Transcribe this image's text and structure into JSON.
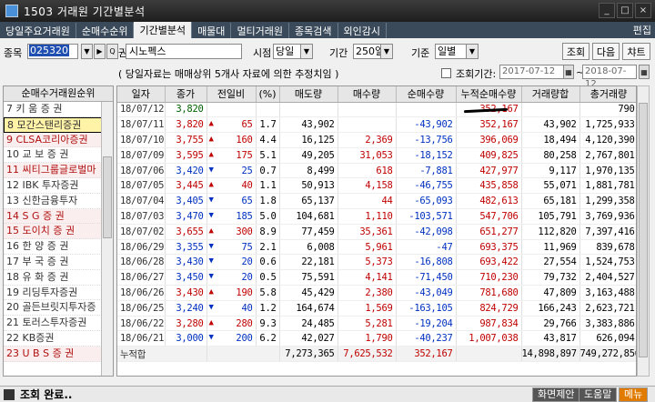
{
  "window": {
    "title": "1503 거래원 기간별분석",
    "edit_label": "편집"
  },
  "tabs": [
    "당일주요거래원",
    "순매수순위",
    "기간별분석",
    "매물대",
    "멀티거래원",
    "종목검색",
    "외인감시"
  ],
  "active_tab": "기간별분석",
  "controls": {
    "code_label": "종목",
    "code_value": "025320",
    "search_glyph": "Q",
    "right_label": "권",
    "name_value": "시노펙스",
    "timepoint_label": "시점",
    "timepoint_value": "당일",
    "period_label": "기간",
    "period_value": "250일",
    "basis_label": "기준",
    "basis_value": "일별",
    "query_btn": "조회",
    "next_btn": "다음",
    "chart_btn": "챠트",
    "note": "( 당일자료는 매매상위 5개사 자료에 의한 추정치임 )",
    "range_label": "조회기간:",
    "date_from": "2017-07-12",
    "date_to": "2018-07-12",
    "range_sep": "~"
  },
  "broker_list": {
    "header": "순매수거래원순위",
    "items": [
      {
        "label": "7 키 움 증 권",
        "style": "normal"
      },
      {
        "label": "8 모간스탠리증권",
        "style": "selected"
      },
      {
        "label": "9 CLSA코리아증권",
        "style": "red"
      },
      {
        "label": "10 교 보 증 권",
        "style": "normal"
      },
      {
        "label": "11 씨티그룹글로벌마",
        "style": "red"
      },
      {
        "label": "12 IBK 투자증권",
        "style": "normal"
      },
      {
        "label": "13 신한금융투자",
        "style": "normal"
      },
      {
        "label": "14 S G 증 권",
        "style": "red"
      },
      {
        "label": "15 도이치 증 권",
        "style": "red"
      },
      {
        "label": "16 한 양 증 권",
        "style": "normal"
      },
      {
        "label": "17 부 국 증 권",
        "style": "normal"
      },
      {
        "label": "18 유 화 증 권",
        "style": "normal"
      },
      {
        "label": "19 리딩투자증권",
        "style": "normal"
      },
      {
        "label": "20 골든브릿지투자증",
        "style": "normal"
      },
      {
        "label": "21 토러스투자증권",
        "style": "normal"
      },
      {
        "label": "22 KB증권",
        "style": "normal"
      },
      {
        "label": "23 U B S 증 권",
        "style": "red"
      }
    ]
  },
  "table": {
    "columns": [
      "일자",
      "종가",
      "전일비",
      "(%)",
      "매도량",
      "매수량",
      "순매수량",
      "누적순매수량",
      "거래량합",
      "총거래량"
    ],
    "rows": [
      {
        "date": "18/07/12",
        "close": "3,820",
        "dir": "",
        "chg": "",
        "pct": "",
        "sell": "",
        "buy": "",
        "net": "",
        "cum": "352,167",
        "vol": "",
        "total": "790"
      },
      {
        "date": "18/07/11",
        "close": "3,820",
        "dir": "up",
        "chg": "65",
        "pct": "1.7",
        "sell": "43,902",
        "buy": "",
        "net": "-43,902",
        "cum": "352,167",
        "vol": "43,902",
        "total": "1,725,933"
      },
      {
        "date": "18/07/10",
        "close": "3,755",
        "dir": "up",
        "chg": "160",
        "pct": "4.4",
        "sell": "16,125",
        "buy": "2,369",
        "net": "-13,756",
        "cum": "396,069",
        "vol": "18,494",
        "total": "4,120,390"
      },
      {
        "date": "18/07/09",
        "close": "3,595",
        "dir": "up",
        "chg": "175",
        "pct": "5.1",
        "sell": "49,205",
        "buy": "31,053",
        "net": "-18,152",
        "cum": "409,825",
        "vol": "80,258",
        "total": "2,767,801"
      },
      {
        "date": "18/07/06",
        "close": "3,420",
        "dir": "dn",
        "chg": "25",
        "pct": "0.7",
        "sell": "8,499",
        "buy": "618",
        "net": "-7,881",
        "cum": "427,977",
        "vol": "9,117",
        "total": "1,970,135"
      },
      {
        "date": "18/07/05",
        "close": "3,445",
        "dir": "up",
        "chg": "40",
        "pct": "1.1",
        "sell": "50,913",
        "buy": "4,158",
        "net": "-46,755",
        "cum": "435,858",
        "vol": "55,071",
        "total": "1,881,781"
      },
      {
        "date": "18/07/04",
        "close": "3,405",
        "dir": "dn",
        "chg": "65",
        "pct": "1.8",
        "sell": "65,137",
        "buy": "44",
        "net": "-65,093",
        "cum": "482,613",
        "vol": "65,181",
        "total": "1,299,358"
      },
      {
        "date": "18/07/03",
        "close": "3,470",
        "dir": "dn",
        "chg": "185",
        "pct": "5.0",
        "sell": "104,681",
        "buy": "1,110",
        "net": "-103,571",
        "cum": "547,706",
        "vol": "105,791",
        "total": "3,769,936"
      },
      {
        "date": "18/07/02",
        "close": "3,655",
        "dir": "up",
        "chg": "300",
        "pct": "8.9",
        "sell": "77,459",
        "buy": "35,361",
        "net": "-42,098",
        "cum": "651,277",
        "vol": "112,820",
        "total": "7,397,416"
      },
      {
        "date": "18/06/29",
        "close": "3,355",
        "dir": "dn",
        "chg": "75",
        "pct": "2.1",
        "sell": "6,008",
        "buy": "5,961",
        "net": "-47",
        "cum": "693,375",
        "vol": "11,969",
        "total": "839,678"
      },
      {
        "date": "18/06/28",
        "close": "3,430",
        "dir": "dn",
        "chg": "20",
        "pct": "0.6",
        "sell": "22,181",
        "buy": "5,373",
        "net": "-16,808",
        "cum": "693,422",
        "vol": "27,554",
        "total": "1,524,753"
      },
      {
        "date": "18/06/27",
        "close": "3,450",
        "dir": "dn",
        "chg": "20",
        "pct": "0.5",
        "sell": "75,591",
        "buy": "4,141",
        "net": "-71,450",
        "cum": "710,230",
        "vol": "79,732",
        "total": "2,404,527"
      },
      {
        "date": "18/06/26",
        "close": "3,430",
        "dir": "up",
        "chg": "190",
        "pct": "5.8",
        "sell": "45,429",
        "buy": "2,380",
        "net": "-43,049",
        "cum": "781,680",
        "vol": "47,809",
        "total": "3,163,488"
      },
      {
        "date": "18/06/25",
        "close": "3,240",
        "dir": "dn",
        "chg": "40",
        "pct": "1.2",
        "sell": "164,674",
        "buy": "1,569",
        "net": "-163,105",
        "cum": "824,729",
        "vol": "166,243",
        "total": "2,623,721"
      },
      {
        "date": "18/06/22",
        "close": "3,280",
        "dir": "up",
        "chg": "280",
        "pct": "9.3",
        "sell": "24,485",
        "buy": "5,281",
        "net": "-19,204",
        "cum": "987,834",
        "vol": "29,766",
        "total": "3,383,886"
      },
      {
        "date": "18/06/21",
        "close": "3,000",
        "dir": "dn",
        "chg": "200",
        "pct": "6.2",
        "sell": "42,027",
        "buy": "1,790",
        "net": "-40,237",
        "cum": "1,007,038",
        "vol": "43,817",
        "total": "626,094"
      }
    ],
    "total_row": {
      "label": "누적합",
      "sell": "7,273,365",
      "buy": "7,625,532",
      "net": "352,167",
      "vol": "14,898,897",
      "total": "749,272,856"
    }
  },
  "status": {
    "message": "조회 완료..",
    "btn_suggest": "화면제안",
    "btn_help": "도움말",
    "btn_menu": "메뉴"
  },
  "colors": {
    "up": "#c00000",
    "down": "#0030c0",
    "selection": "#1f4fb0",
    "menu": "#e07b00"
  }
}
